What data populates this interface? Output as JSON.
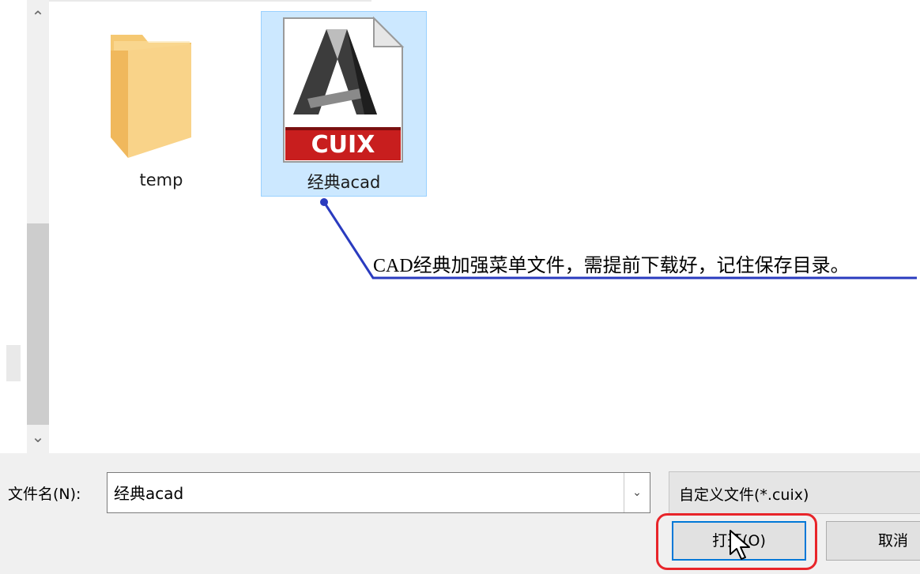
{
  "file_list": {
    "items": [
      {
        "name": "temp",
        "type": "folder",
        "selected": false
      },
      {
        "name": "经典acad",
        "type": "cuix-file",
        "selected": true,
        "icon_badge": "CUIX"
      }
    ]
  },
  "annotation": {
    "text": "CAD经典加强菜单文件，需提前下载好，记住保存目录。",
    "line_color": "#2a3bbf"
  },
  "scrollbar": {
    "up_icon": "chevron-up-icon",
    "down_icon": "chevron-down-icon"
  },
  "footer": {
    "filename_label": "文件名(N):",
    "filename_value": "经典acad",
    "filter_value": "自定义文件(*.cuix)",
    "open_button": "打开(O)",
    "cancel_button": "取消"
  },
  "colors": {
    "selection_bg": "#cce8ff",
    "selection_border": "#99d1ff",
    "highlight_ring": "#e8252a",
    "accent": "#0078d7",
    "badge_red": "#c81e1e"
  }
}
